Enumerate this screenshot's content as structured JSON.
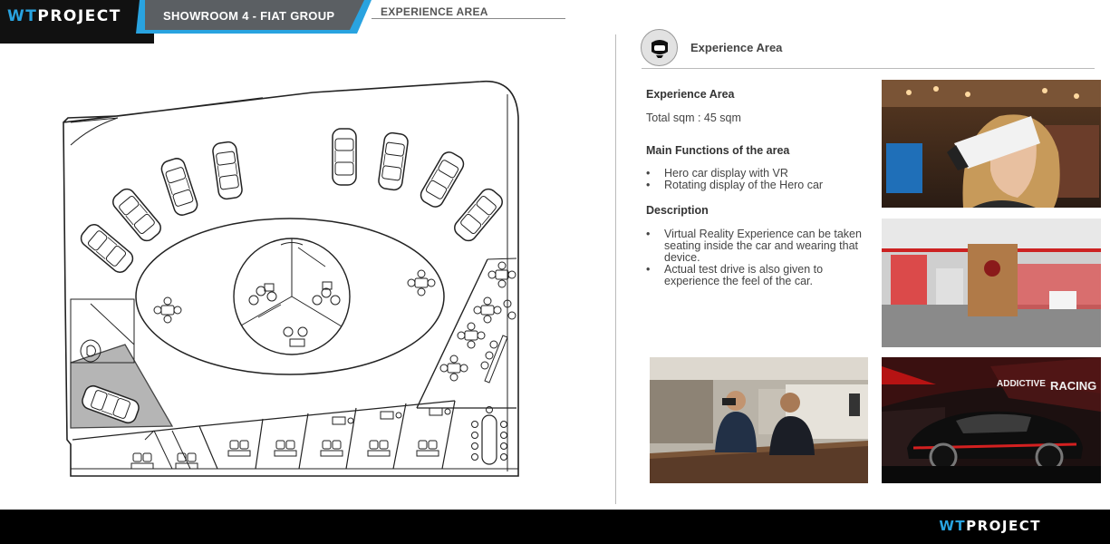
{
  "header": {
    "logo_wt": "WT",
    "logo_project": "PROJECT",
    "title": "SHOWROOM  4  -  FIAT GROUP",
    "section": "EXPERIENCE AREA"
  },
  "panel": {
    "icon": "vr-headset-icon",
    "heading": "Experience Area"
  },
  "info": {
    "area_title": "Experience Area",
    "total_sqm": "Total sqm   : 45 sqm",
    "functions_title": "Main Functions of the area",
    "functions": [
      "Hero car display with VR",
      "Rotating display of the Hero car"
    ],
    "description_title": "Description",
    "description": [
      "Virtual Reality Experience can be taken seating inside the car and wearing that device.",
      "Actual test drive is also given to experience the feel of the car."
    ]
  },
  "photos": {
    "racing_banner_1": "ADDICTIVE",
    "racing_banner_2": "RACING"
  },
  "colors": {
    "accent": "#29a3e0",
    "header_bar": "#5b5f63",
    "footer": "#000000"
  },
  "footer": {
    "logo_wt": "WT",
    "logo_project": "PROJECT"
  }
}
